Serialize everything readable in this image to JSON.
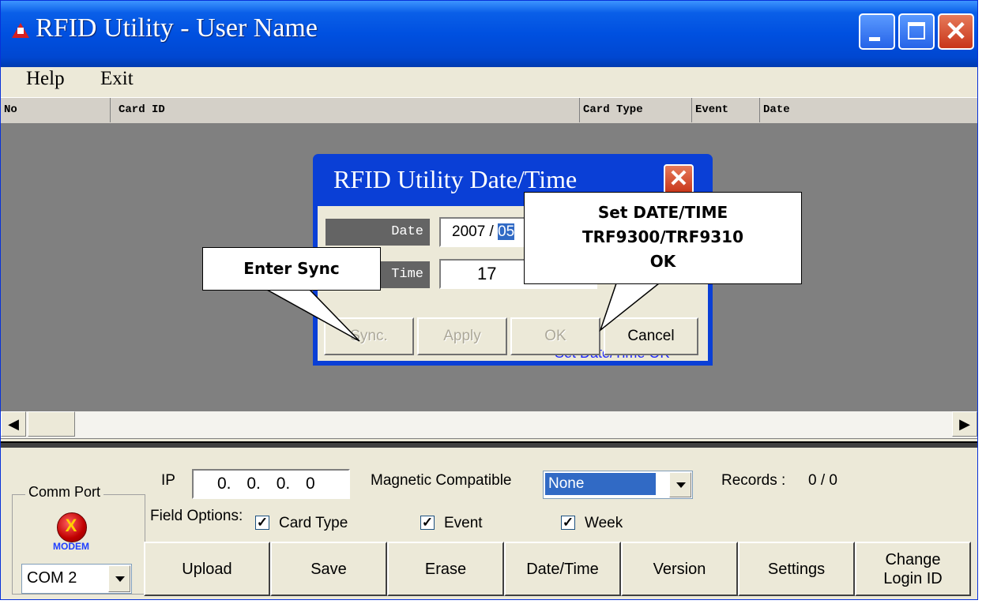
{
  "window": {
    "title": "RFID Utility  -  User Name",
    "accent": "#0a5fe8",
    "controls": {
      "minimize": "minimize-icon",
      "maximize": "maximize-icon",
      "close": "close-icon"
    }
  },
  "menu": {
    "help": "Help",
    "exit": "Exit"
  },
  "list": {
    "columns": [
      "No",
      "Card ID",
      "Card Type",
      "Event",
      "Date"
    ]
  },
  "scroll": {
    "left": "◀",
    "right": "▶"
  },
  "dialog": {
    "title": "RFID Utility Date/Time",
    "date_label": "Date",
    "date_value": "2007 / ",
    "date_selected": "05",
    "time_label": "Time",
    "time_value": "17",
    "status": "Set Date/Time OK",
    "buttons": {
      "sync": "Sync.",
      "apply": "Apply",
      "ok": "OK",
      "cancel": "Cancel"
    }
  },
  "callouts": {
    "enter_sync": "Enter Sync",
    "set_datetime": "Set DATE/TIME\nTRF9300/TRF9310\nOK"
  },
  "comm": {
    "group_label": "Comm Port",
    "modem_label": "MODEM",
    "port": "COM 2"
  },
  "ip": {
    "label": "IP",
    "value": "0.  0.  0.  0"
  },
  "magnetic": {
    "label": "Magnetic Compatible",
    "value": "None"
  },
  "records": {
    "label": "Records :",
    "value": "0 / 0"
  },
  "fields": {
    "label": "Field Options:",
    "card_type": "Card Type",
    "event": "Event",
    "week": "Week",
    "check_glyph": "✓"
  },
  "buttons": [
    "Upload",
    "Save",
    "Erase",
    "Date/Time",
    "Version",
    "Settings",
    "Change\nLogin ID"
  ]
}
